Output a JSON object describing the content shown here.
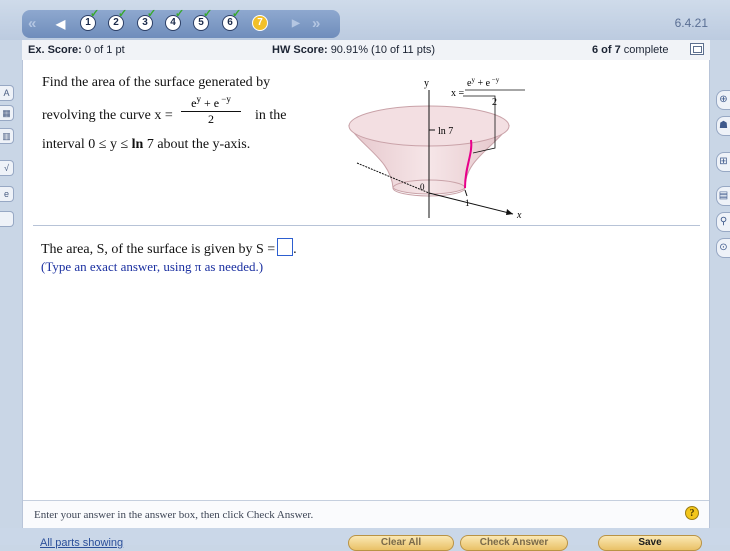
{
  "nav": {
    "questions": [
      {
        "label": "1",
        "done": true
      },
      {
        "label": "2",
        "done": true
      },
      {
        "label": "3",
        "done": true
      },
      {
        "label": "4",
        "done": true
      },
      {
        "label": "5",
        "done": true
      },
      {
        "label": "6",
        "done": true
      },
      {
        "label": "7",
        "done": false,
        "current": true
      }
    ],
    "first_glyph": "«",
    "prev_glyph": "◀",
    "next_glyph": "▶",
    "last_glyph": "»",
    "version": "6.4.21",
    "check_glyph": "✓"
  },
  "score": {
    "ex_label": "Ex. Score:",
    "ex_value": "0 of 1 pt",
    "hw_label": "HW Score:",
    "hw_value": "90.91% (10 of 11 pts)",
    "progress_bold": "6 of 7",
    "progress_rest": "complete"
  },
  "question": {
    "line1": "Find the area of the surface generated by",
    "line2_pre": "revolving the curve x =",
    "line2_post": "in the",
    "line3_pre": "interval 0 ≤ y ≤ ",
    "line3_ln": "ln",
    "line3_post": " 7 about the y-axis.",
    "frac_num_base1": "e",
    "frac_num_sup1": "y",
    "frac_num_mid": " + e",
    "frac_num_sup2": " −y",
    "frac_den": "2"
  },
  "figure": {
    "y_label": "y",
    "x_label": "x",
    "x_eq": "x =",
    "ln_label": "ln 7",
    "zero_label": "0",
    "one_label": "1",
    "curve_color": "#e8008a"
  },
  "answer": {
    "prompt": "The area, S, of the surface is given by S =",
    "after_box": ".",
    "hint": "(Type an exact answer, using π as needed.)"
  },
  "instructions": {
    "text": "Enter your answer in the answer box, then click Check Answer.",
    "help_glyph": "?"
  },
  "bottom": {
    "all_parts": "All parts showing",
    "clear_all": "Clear All",
    "check_answer": "Check Answer",
    "save": "Save"
  },
  "left_tools": [
    "A",
    "▦",
    "▥",
    "√",
    "e",
    ""
  ],
  "right_tools": [
    "⊕",
    "☗",
    "⊞",
    "▤",
    "⚲",
    "⊙"
  ]
}
